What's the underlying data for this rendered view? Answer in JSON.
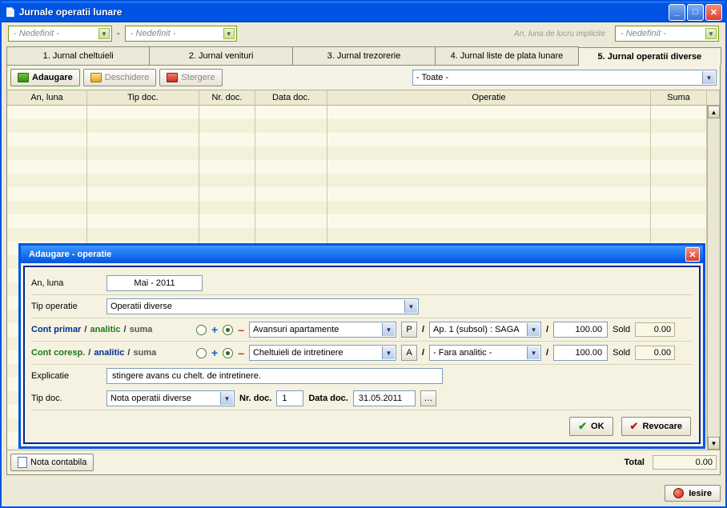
{
  "window": {
    "title": "Jurnale operatii lunare"
  },
  "top": {
    "combo1": "- Nedefinit -",
    "combo2": "- Nedefinit -",
    "combo3": "- Nedefinit -",
    "note": "An, luna de lucru implicite"
  },
  "tabs": [
    "1. Jurnal cheltuieli",
    "2. Jurnal venituri",
    "3. Jurnal trezorerie",
    "4. Jurnal liste de plata lunare",
    "5. Jurnal operatii diverse"
  ],
  "actions": {
    "add": "Adaugare",
    "open": "Deschidere",
    "del": "Stergere",
    "filter": "- Toate -"
  },
  "grid": {
    "cols": {
      "anluna": "An, luna",
      "tip": "Tip doc.",
      "nr": "Nr. doc.",
      "data": "Data doc.",
      "op": "Operatie",
      "suma": "Suma"
    }
  },
  "footer": {
    "nota": "Nota contabila",
    "total_label": "Total",
    "total_value": "0.00",
    "exit": "Iesire"
  },
  "dialog": {
    "title": "Adaugare - operatie",
    "anluna_label": "An, luna",
    "anluna_value": "Mai - 2011",
    "tipop_label": "Tip operatie",
    "tipop_value": "Operatii diverse",
    "primary": {
      "label_a": "Cont primar",
      "label_b": "analitic",
      "label_c": "suma",
      "account": "Avansuri apartamente",
      "btn": "P",
      "analytic": "Ap. 1 (subsol) : SAGA",
      "amount": "100.00",
      "sold_label": "Sold",
      "sold_value": "0.00"
    },
    "coresp": {
      "label_a": "Cont coresp.",
      "label_b": "analitic",
      "label_c": "suma",
      "account": "Cheltuieli de intretinere",
      "btn": "A",
      "analytic": "- Fara analitic -",
      "amount": "100.00",
      "sold_label": "Sold",
      "sold_value": "0.00"
    },
    "explic_label": "Explicatie",
    "explic_value": "stingere avans cu chelt. de intretinere.",
    "tipdoc_label": "Tip doc.",
    "tipdoc_value": "Nota operatii diverse",
    "nrdoc_label": "Nr. doc.",
    "nrdoc_value": "1",
    "datadoc_label": "Data doc.",
    "datadoc_value": "31.05.2011",
    "ok": "OK",
    "cancel": "Revocare"
  }
}
